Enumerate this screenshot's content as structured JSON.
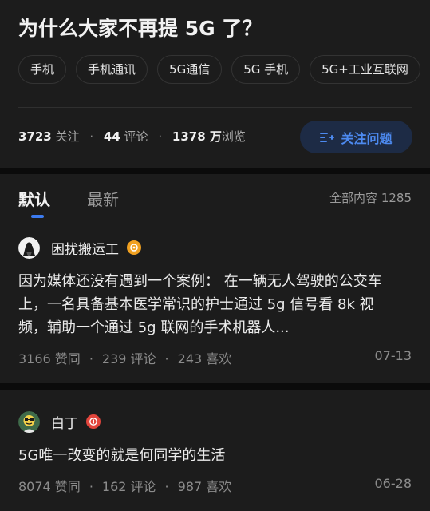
{
  "question": {
    "title": "为什么大家不再提 5G 了？",
    "tags": [
      "手机",
      "手机通讯",
      "5G通信",
      "5G 手机",
      "5G+工业互联网"
    ],
    "stats": {
      "followers": "3723",
      "followers_unit": "关注",
      "comments": "44",
      "comments_unit": "评论",
      "views": "1378 万",
      "views_unit": "浏览"
    },
    "follow_button": "关注问题"
  },
  "tabs": {
    "default": "默认",
    "latest": "最新",
    "total": "全部内容 1285"
  },
  "answers": [
    {
      "author": "困扰搬运工",
      "excerpt": "因为媒体还没有遇到一个案例： 在一辆无人驾驶的公交车上，一名具备基本医学常识的护士通过 5g 信号看 8k 视频，辅助一个通过 5g 联网的手术机器人...",
      "likes": "3166 赞同",
      "comments": "239 评论",
      "favorites": "243 喜欢",
      "date": "07-13",
      "badge_color": "#f0a020"
    },
    {
      "author": "白丁",
      "excerpt": "5G唯一改变的就是何同学的生活",
      "likes": "8074 赞同",
      "comments": "162 评论",
      "favorites": "987 喜欢",
      "date": "06-28",
      "badge_color": "#e2453c"
    }
  ],
  "colors": {
    "background": "#1c1c1c",
    "accent": "#3c7bf0",
    "follow_button_bg": "#1d2b45"
  }
}
